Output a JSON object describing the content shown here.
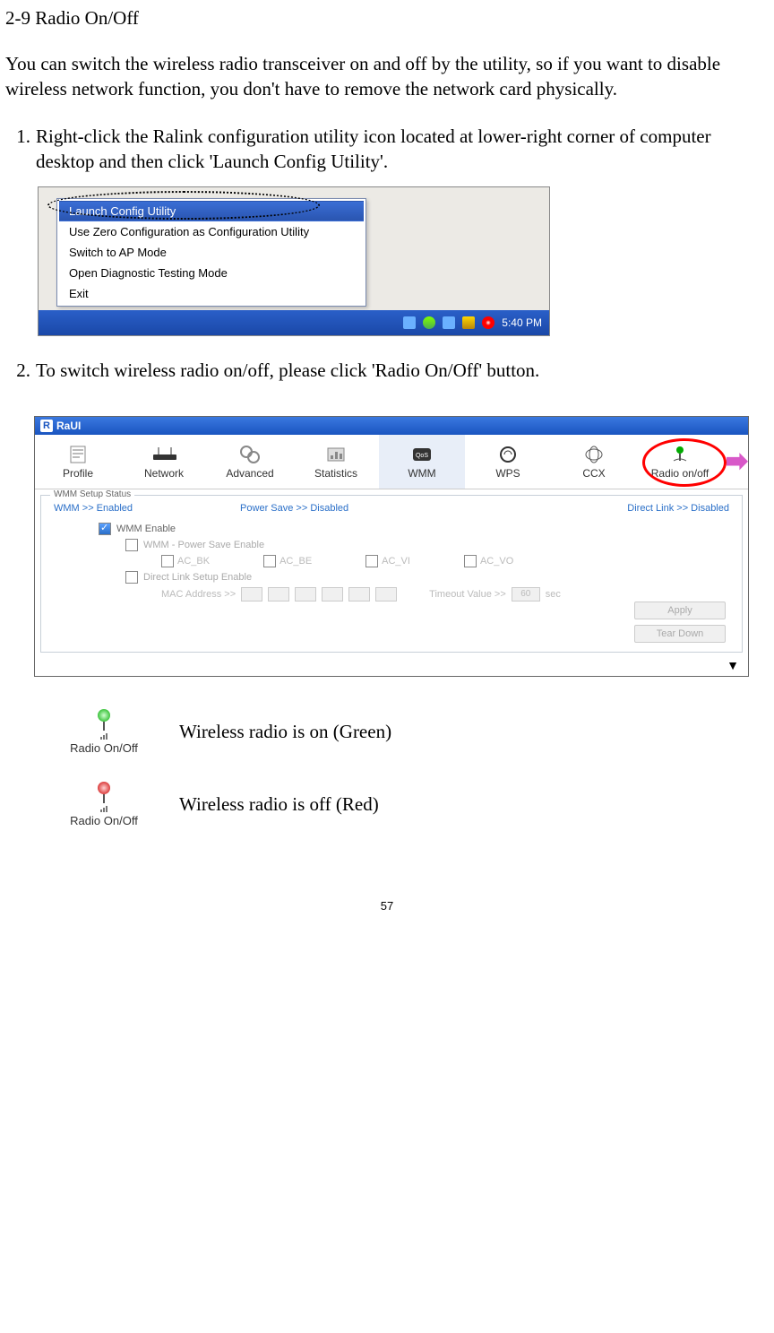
{
  "section_title": "2-9 Radio On/Off",
  "intro": "You can switch the wireless radio transceiver on and off by the utility, so if you want to disable wireless network function, you don't have to remove the network card physically.",
  "step1_num": "1.",
  "step1": "Right-click the Ralink configuration utility icon located at lower-right corner of computer desktop and then click 'Launch Config Utility'.",
  "step2_num": "2.",
  "step2": "To switch wireless radio on/off, please click 'Radio On/Off' button.",
  "context_menu": {
    "items": [
      "Launch Config Utility",
      "Use Zero Configuration as Configuration Utility",
      "Switch to AP Mode",
      "Open Diagnostic Testing Mode",
      "Exit"
    ]
  },
  "taskbar_time": "5:40 PM",
  "raui": {
    "title": "RaUI",
    "tabs": [
      "Profile",
      "Network",
      "Advanced",
      "Statistics",
      "WMM",
      "WPS",
      "CCX",
      "Radio on/off"
    ],
    "wmm_panel": {
      "group_label": "WMM Setup Status",
      "status": {
        "wmm": "WMM >> Enabled",
        "power": "Power Save >> Disabled",
        "direct": "Direct Link >> Disabled"
      },
      "checks": {
        "wmm_enable": "WMM Enable",
        "power_save": "WMM - Power Save Enable",
        "ac": [
          "AC_BK",
          "AC_BE",
          "AC_VI",
          "AC_VO"
        ],
        "direct_link": "Direct Link Setup Enable",
        "mac_label": "MAC Address >>",
        "timeout_label": "Timeout Value >>",
        "timeout_value": "60",
        "timeout_unit": "sec"
      },
      "buttons": {
        "apply": "Apply",
        "tear": "Tear Down"
      }
    }
  },
  "legend": {
    "label_btn": "Radio On/Off",
    "on_text": "Wireless radio is on (Green)",
    "off_text": "Wireless radio is off (Red)"
  },
  "page_number": "57"
}
